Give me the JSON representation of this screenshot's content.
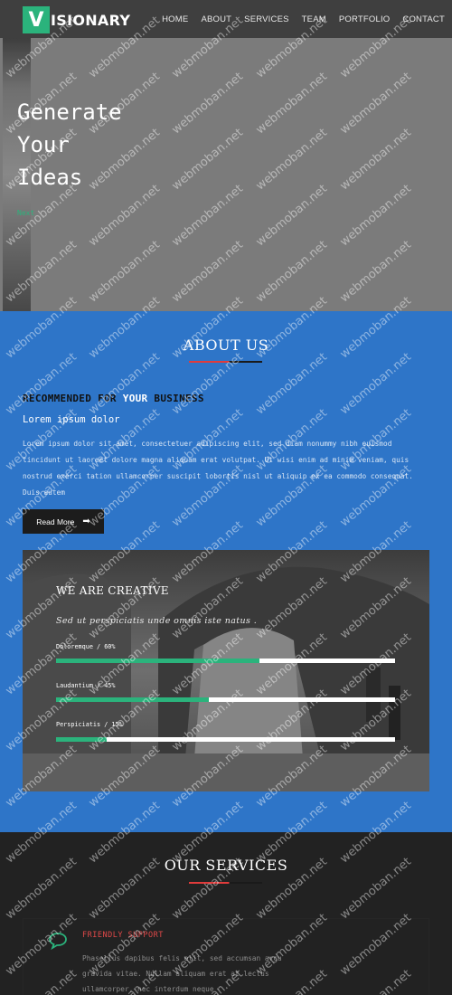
{
  "nav": {
    "logo_letter": "V",
    "logo_rest": "ISIONARY",
    "items": [
      {
        "label": "HOME"
      },
      {
        "label": "ABOUT"
      },
      {
        "label": "SERVICES"
      },
      {
        "label": "TEAM"
      },
      {
        "label": "PORTFOLIO"
      },
      {
        "label": "CONTACT"
      }
    ]
  },
  "hero": {
    "title": "Generate\nYour\nIdeas",
    "next_label": "Next"
  },
  "about": {
    "title": "ABOUT US",
    "rec_prefix": "RECOMMENDED FOR ",
    "rec_highlight": "YOUR",
    "rec_suffix": " BUSINESS",
    "subheading": "Lorem ipsum dolor",
    "paragraph": "Lorem ipsum dolor sit amet, consectetuer adipiscing elit, sed diam nonummy nibh euismod tincidunt ut laoreet dolore magna aliquam erat volutpat. Ut wisi enim ad minim veniam, quis nostrud exerci tation ullamcorper suscipit lobortis nisl ut aliquip ex ea commodo consequat. Duis autem",
    "read_more": "Read More",
    "arrow_icon": "arrow-right-icon"
  },
  "creative": {
    "title": "WE ARE CREATIVE",
    "subtitle": "Sed ut perspiciatis unde omnis iste natus .",
    "bars": [
      {
        "label": "Doloremque / 60%",
        "percent": 60
      },
      {
        "label": "Laudantium / 45%",
        "percent": 45
      },
      {
        "label": "Perspiciatis / 15%",
        "percent": 15
      }
    ]
  },
  "services": {
    "title": "OUR SERVICES",
    "items": [
      {
        "icon": "chat-bubble-icon",
        "title": "FRIENDLY SUPPORT",
        "text": "Phasellus dapibus felis elit, sed accumsan arcu gravida vitae. Nullam aliquam erat at lectus ullamcorper, nec interdum neque"
      }
    ]
  },
  "watermark": "webmoban.net",
  "colors": {
    "accent_green": "#2bb37c",
    "about_blue": "#2e75c8",
    "accent_red": "#e03b3b",
    "nav_bg": "#3f3f3f",
    "hero_bg": "#7b7b7b",
    "services_bg": "#222222"
  }
}
